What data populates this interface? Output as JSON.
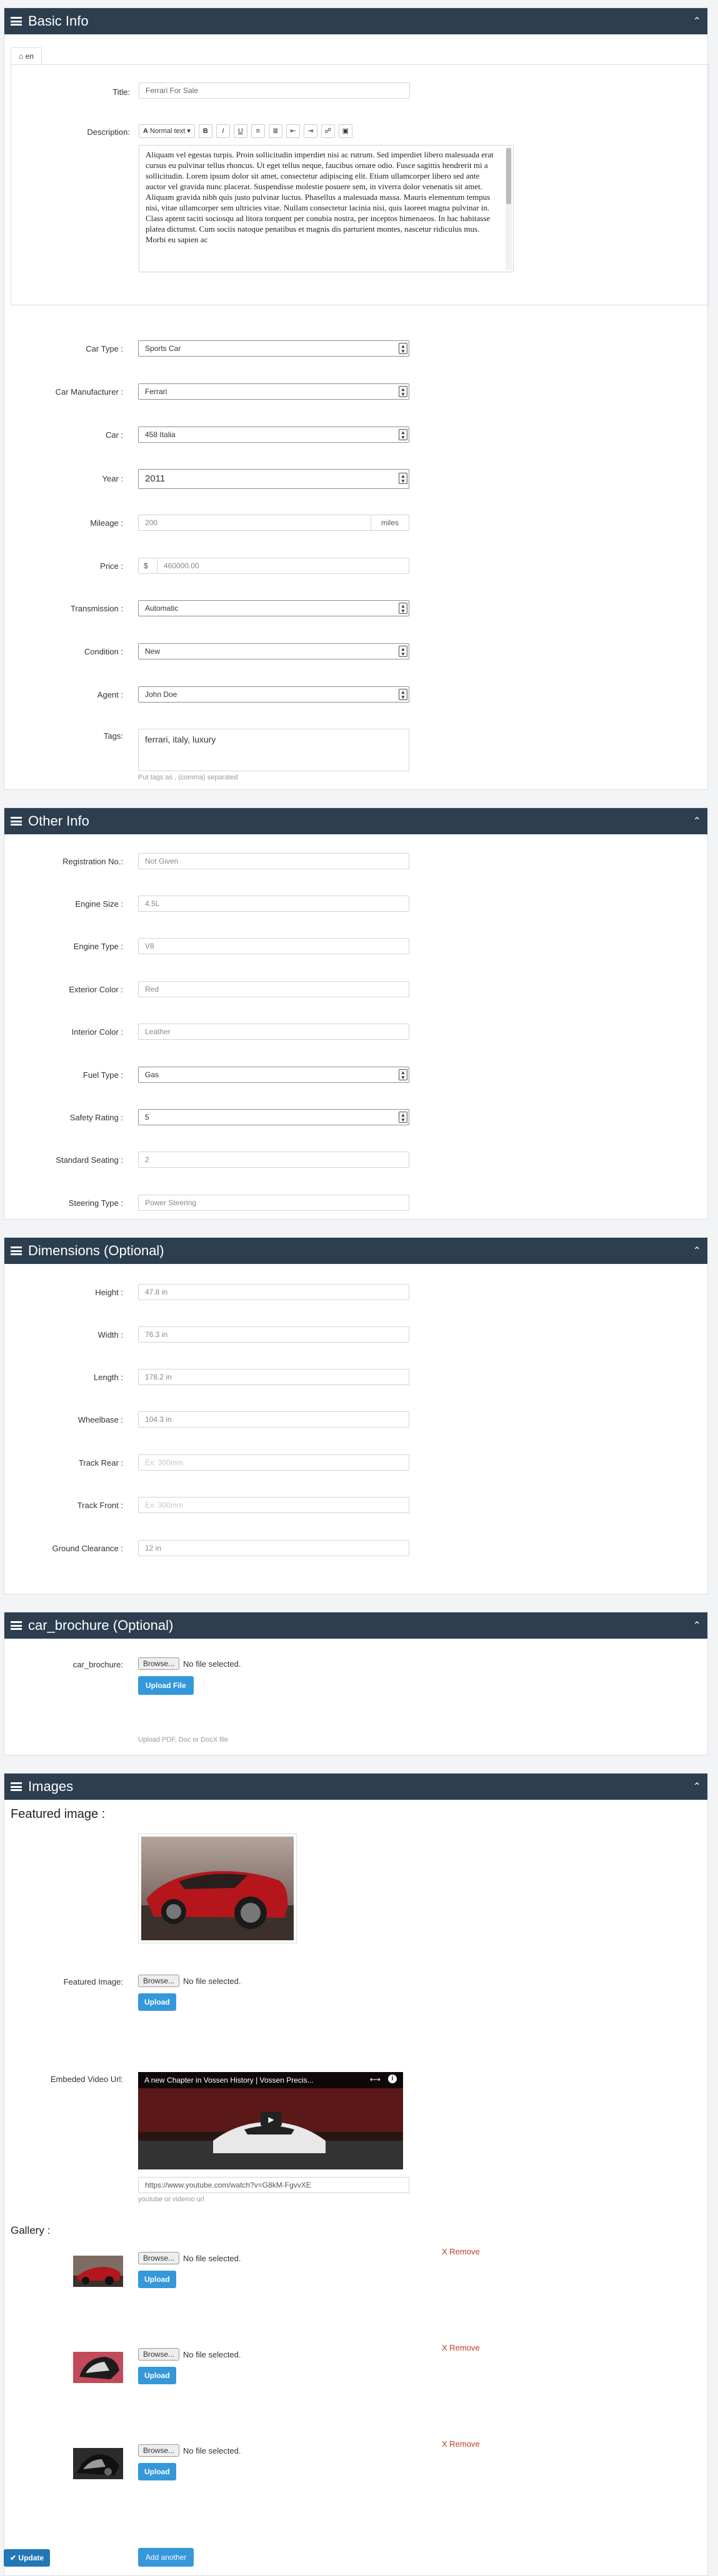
{
  "basic_info": {
    "title": "Basic Info",
    "tab_label": "en",
    "title_label": "Title:",
    "title_value": "Ferrari For Sale",
    "description_label": "Description:",
    "toolbar": {
      "format": "Normal text",
      "bold": "B",
      "italic": "I",
      "underline": "U"
    },
    "description_text": "Aliquam vel egestas turpis. Proin sollicitudin imperdiet nisi ac rutrum. Sed imperdiet libero malesuada erat cursus eu pulvinar tellus rhoncus. Ut eget tellus neque, faucibus ornare odio. Fusce sagittis hendrerit mi a sollicitudin. Lorem ipsum dolor sit amet, consectetur adipiscing elit. Etiam ullamcorper libero sed ante auctor vel gravida nunc placerat. Suspendisse molestie posuere sem, in viverra dolor venenatis sit amet. Aliquam gravida nibh quis justo pulvinar luctus. Phasellus a malesuada massa. Mauris elementum tempus nisi, vitae ullamcorper sem ultricies vitae. Nullam consectetur lacinia nisi, quis laoreet magna pulvinar in. Class aptent taciti sociosqu ad litora torquent per conubia nostra, per inceptos himenaeos. In hac habitasse platea dictumst. Cum sociis natoque penatibus et magnis dis parturient montes, nascetur ridiculus mus. Morbi eu sapien ac",
    "car_type_label": "Car Type :",
    "car_type_value": "Sports Car",
    "manufacturer_label": "Car Manufacturer :",
    "manufacturer_value": "Ferrari",
    "car_label": "Car :",
    "car_value": "458 Italia",
    "year_label": "Year :",
    "year_value": "2011",
    "mileage_label": "Mileage :",
    "mileage_value": "200",
    "mileage_unit": "miles",
    "price_label": "Price :",
    "price_currency": "$",
    "price_value": "460000.00",
    "transmission_label": "Transmission :",
    "transmission_value": "Automatic",
    "condition_label": "Condition :",
    "condition_value": "New",
    "agent_label": "Agent :",
    "agent_value": "John Doe",
    "tags_label": "Tags:",
    "tags_value": "ferrari, italy, luxury",
    "tags_help": "Put tags as , (comma) separated"
  },
  "other_info": {
    "title": "Other Info",
    "fields": [
      {
        "label": "Registration No.:",
        "value": "Not Given"
      },
      {
        "label": "Engine Size :",
        "value": "4.5L"
      },
      {
        "label": "Engine Type :",
        "value": "V8"
      },
      {
        "label": "Exterior Color :",
        "value": "Red"
      },
      {
        "label": "Interior Color :",
        "value": "Leather"
      }
    ],
    "fuel_label": "Fuel Type :",
    "fuel_value": "Gas",
    "safety_label": "Safety Rating :",
    "safety_value": "5",
    "seating_label": "Standard Seating :",
    "seating_value": "2",
    "steering_label": "Steering Type :",
    "steering_value": "Power Steering"
  },
  "dimensions": {
    "title": "Dimensions (Optional)",
    "fields": [
      {
        "label": "Height :",
        "value": "47.8 in"
      },
      {
        "label": "Width :",
        "value": "76.3 in"
      },
      {
        "label": "Length :",
        "value": "178.2 in"
      },
      {
        "label": "Wheelbase :",
        "value": "104.3 in"
      },
      {
        "label": "Track Rear :",
        "value": "Ex: 300mm"
      },
      {
        "label": "Track Front :",
        "value": "Ex: 300mm"
      },
      {
        "label": "Ground Clearance :",
        "value": "12 in"
      }
    ]
  },
  "brochure": {
    "title": "car_brochure (Optional)",
    "label": "car_brochure:",
    "browse": "Browse...",
    "no_file": "No file selected.",
    "upload": "Upload File",
    "help": "Upload PDF, Doc or DocX file"
  },
  "images": {
    "title": "Images",
    "featured_heading": "Featured image :",
    "featured_label": "Featured Image:",
    "browse": "Browse...",
    "no_file": "No file selected.",
    "upload": "Upload",
    "video_label": "Embeded Video Url:",
    "video_title": "A new Chapter in Vossen History | Vossen Precis...",
    "video_url": "https://www.youtube.com/watch?v=G8kM-FgvvXE",
    "video_help": "youtube or videmo url",
    "gallery_heading": "Gallery :",
    "remove": "X Remove",
    "add_another": "Add another"
  },
  "update_button": "Update",
  "colors": {
    "header": "#2c3e50",
    "primary": "#3498db",
    "danger": "#c0392b"
  }
}
